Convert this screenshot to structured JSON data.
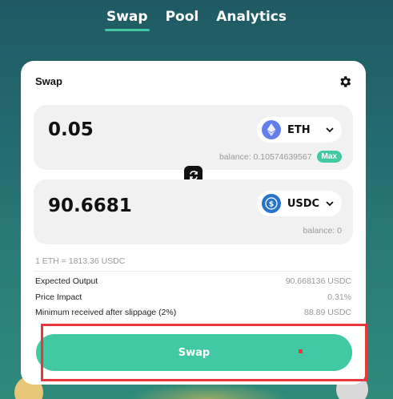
{
  "nav": {
    "tabs": [
      {
        "label": "Swap",
        "active": true
      },
      {
        "label": "Pool",
        "active": false
      },
      {
        "label": "Analytics",
        "active": false
      }
    ]
  },
  "card": {
    "title": "Swap",
    "from": {
      "amount": "0.05",
      "token": "ETH",
      "balance": "balance: 0.10574639567",
      "max_label": "Max"
    },
    "to": {
      "amount": "90.6681",
      "token": "USDC",
      "balance": "balance: 0"
    },
    "rate": "1 ETH = 1813.36 USDC",
    "details": [
      {
        "label": "Expected Output",
        "value": "90.668136 USDC"
      },
      {
        "label": "Price Impact",
        "value": "0.31%"
      },
      {
        "label": "Minimum received after slippage (2%)",
        "value": "88.89 USDC"
      }
    ],
    "swap_button": "Swap"
  },
  "colors": {
    "accent": "#40c9a2",
    "highlight": "#e8383d",
    "eth": "#627eea",
    "usdc": "#2775ca"
  },
  "icons": [
    "gear-icon",
    "eth-icon",
    "usdc-icon",
    "chevron-down-icon",
    "switch-arrows-icon"
  ]
}
